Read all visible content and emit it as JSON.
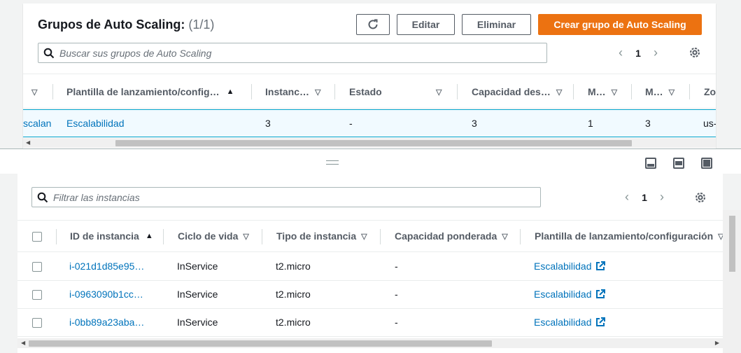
{
  "top": {
    "title": "Grupos de Auto Scaling:",
    "count": "(1/1)",
    "buttons": {
      "edit": "Editar",
      "delete": "Eliminar",
      "create": "Crear grupo de Auto Scaling"
    },
    "search_placeholder": "Buscar sus grupos de Auto Scaling",
    "page": "1",
    "columns": [
      "Plantilla de lanzamiento/config…",
      "Instanc…",
      "Estado",
      "Capacidad des…",
      "M…",
      "M…",
      "Zo"
    ],
    "row": {
      "name_fragment": "scalan",
      "template": "Escalabilidad",
      "instances": "3",
      "status": "-",
      "desired": "3",
      "min": "1",
      "max": "3",
      "zone": "us-"
    }
  },
  "bottom": {
    "search_placeholder": "Filtrar las instancias",
    "page": "1",
    "columns": [
      "ID de instancia",
      "Ciclo de vida",
      "Tipo de instancia",
      "Capacidad ponderada",
      "Plantilla de lanzamiento/configuración"
    ],
    "rows": [
      {
        "id": "i-021d1d85e95…",
        "lifecycle": "InService",
        "type": "t2.micro",
        "weight": "-",
        "template": "Escalabilidad"
      },
      {
        "id": "i-0963090b1cc…",
        "lifecycle": "InService",
        "type": "t2.micro",
        "weight": "-",
        "template": "Escalabilidad"
      },
      {
        "id": "i-0bb89a23aba…",
        "lifecycle": "InService",
        "type": "t2.micro",
        "weight": "-",
        "template": "Escalabilidad"
      }
    ]
  },
  "colors": {
    "accent": "#ec7211",
    "link": "#0073bb",
    "selected_row": "#f1faff"
  }
}
